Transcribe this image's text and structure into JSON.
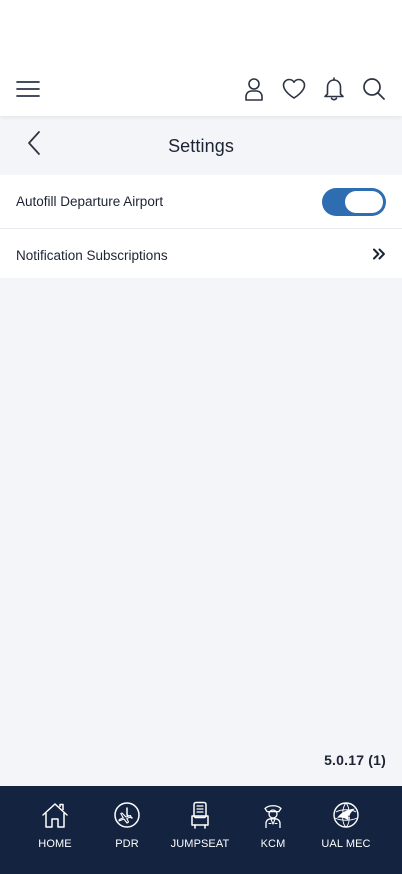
{
  "header": {
    "menu_icon": "hamburger-menu-icon",
    "profile_icon": "profile-icon",
    "favorites_icon": "heart-icon",
    "notifications_icon": "bell-icon",
    "search_icon": "search-icon"
  },
  "page": {
    "title": "Settings",
    "back_icon": "chevron-left-icon"
  },
  "settings": {
    "items": [
      {
        "label": "Autofill Departure Airport",
        "type": "toggle",
        "enabled": true
      },
      {
        "label": "Notification Subscriptions",
        "type": "link",
        "icon": "double-chevron-right-icon"
      }
    ]
  },
  "footer": {
    "version": "5.0.17 (1)"
  },
  "bottom_nav": {
    "items": [
      {
        "label": "HOME",
        "icon": "home-icon"
      },
      {
        "label": "PDR",
        "icon": "pdr-clock-plane-icon"
      },
      {
        "label": "JUMPSEAT",
        "icon": "jumpseat-icon"
      },
      {
        "label": "KCM",
        "icon": "pilot-icon"
      },
      {
        "label": "UAL MEC",
        "icon": "alpa-globe-icon"
      }
    ]
  },
  "colors": {
    "page_background": "#f3f5f9",
    "card_background": "#ffffff",
    "toggle_on": "#2f6db3",
    "bottom_nav_background": "#132340",
    "text_primary": "#1c2434"
  }
}
